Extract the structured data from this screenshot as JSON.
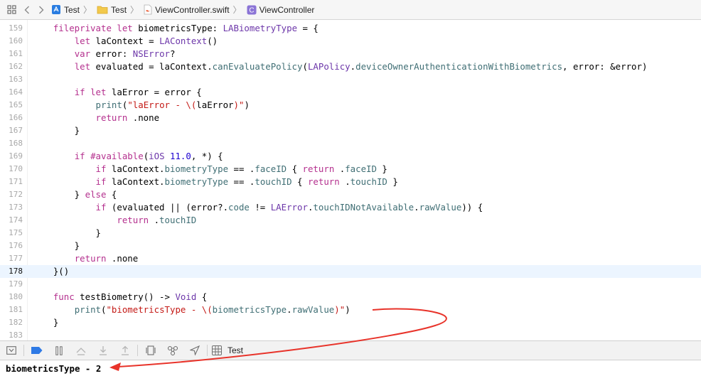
{
  "jumpbar": {
    "crumbs": [
      {
        "label": "Test",
        "icon": "project-file-icon"
      },
      {
        "label": "Test",
        "icon": "folder-icon"
      },
      {
        "label": "ViewController.swift",
        "icon": "swift-file-icon"
      },
      {
        "label": "ViewController",
        "icon": "class-c-icon"
      }
    ]
  },
  "editor": {
    "current_line": "178",
    "lines": [
      {
        "n": "159",
        "t": [
          [
            "    ",
            ""
          ],
          [
            "fileprivate",
            "kw"
          ],
          [
            " ",
            ""
          ],
          [
            "let",
            "kw"
          ],
          [
            " biometricsType: ",
            ""
          ],
          [
            "LABiometryType",
            "ty"
          ],
          [
            " = {",
            ""
          ]
        ]
      },
      {
        "n": "160",
        "t": [
          [
            "        ",
            ""
          ],
          [
            "let",
            "kw"
          ],
          [
            " laContext = ",
            ""
          ],
          [
            "LAContext",
            "ty"
          ],
          [
            "()",
            ""
          ]
        ]
      },
      {
        "n": "161",
        "t": [
          [
            "        ",
            ""
          ],
          [
            "var",
            "kw"
          ],
          [
            " error: ",
            ""
          ],
          [
            "NSError",
            "ty"
          ],
          [
            "?",
            ""
          ]
        ]
      },
      {
        "n": "162",
        "t": [
          [
            "        ",
            ""
          ],
          [
            "let",
            "kw"
          ],
          [
            " evaluated = laContext.",
            ""
          ],
          [
            "canEvaluatePolicy",
            "fn"
          ],
          [
            "(",
            ""
          ],
          [
            "LAPolicy",
            "ty"
          ],
          [
            ".",
            ""
          ],
          [
            "deviceOwnerAuthenticationWithBiometrics",
            "fn"
          ],
          [
            ", error: &error)",
            ""
          ]
        ]
      },
      {
        "n": "163",
        "t": []
      },
      {
        "n": "164",
        "t": [
          [
            "        ",
            ""
          ],
          [
            "if",
            "kw"
          ],
          [
            " ",
            ""
          ],
          [
            "let",
            "kw"
          ],
          [
            " laError = error {",
            ""
          ]
        ]
      },
      {
        "n": "165",
        "t": [
          [
            "            ",
            ""
          ],
          [
            "print",
            "fn"
          ],
          [
            "(",
            ""
          ],
          [
            "\"laError - \\(",
            ""
          ],
          [
            "laError",
            ""
          ],
          [
            ")\"",
            "st"
          ],
          [
            ")",
            ""
          ]
        ]
      },
      {
        "n": "166",
        "t": [
          [
            "            ",
            ""
          ],
          [
            "return",
            "kw"
          ],
          [
            " .none",
            ""
          ]
        ]
      },
      {
        "n": "167",
        "t": [
          [
            "        }",
            ""
          ]
        ]
      },
      {
        "n": "168",
        "t": []
      },
      {
        "n": "169",
        "t": [
          [
            "        ",
            ""
          ],
          [
            "if",
            "kw"
          ],
          [
            " ",
            ""
          ],
          [
            "#available",
            "kw"
          ],
          [
            "(",
            ""
          ],
          [
            "iOS",
            "ty"
          ],
          [
            " ",
            ""
          ],
          [
            "11.0",
            "num"
          ],
          [
            ", *) {",
            ""
          ]
        ]
      },
      {
        "n": "170",
        "t": [
          [
            "            ",
            ""
          ],
          [
            "if",
            "kw"
          ],
          [
            " laContext.",
            ""
          ],
          [
            "biometryType",
            "fn"
          ],
          [
            " == .",
            ""
          ],
          [
            "faceID",
            "fn"
          ],
          [
            " { ",
            ""
          ],
          [
            "return",
            "kw"
          ],
          [
            " .",
            ""
          ],
          [
            "faceID",
            "fn"
          ],
          [
            " }",
            ""
          ]
        ]
      },
      {
        "n": "171",
        "t": [
          [
            "            ",
            ""
          ],
          [
            "if",
            "kw"
          ],
          [
            " laContext.",
            ""
          ],
          [
            "biometryType",
            "fn"
          ],
          [
            " == .",
            ""
          ],
          [
            "touchID",
            "fn"
          ],
          [
            " { ",
            ""
          ],
          [
            "return",
            "kw"
          ],
          [
            " .",
            ""
          ],
          [
            "touchID",
            "fn"
          ],
          [
            " }",
            ""
          ]
        ]
      },
      {
        "n": "172",
        "t": [
          [
            "        } ",
            ""
          ],
          [
            "else",
            "kw"
          ],
          [
            " {",
            ""
          ]
        ]
      },
      {
        "n": "173",
        "t": [
          [
            "            ",
            ""
          ],
          [
            "if",
            "kw"
          ],
          [
            " (evaluated || (error?.",
            ""
          ],
          [
            "code",
            "fn"
          ],
          [
            " != ",
            ""
          ],
          [
            "LAError",
            "ty"
          ],
          [
            ".",
            ""
          ],
          [
            "touchIDNotAvailable",
            "fn"
          ],
          [
            ".",
            ""
          ],
          [
            "rawValue",
            "fn"
          ],
          [
            ")) {",
            ""
          ]
        ]
      },
      {
        "n": "174",
        "t": [
          [
            "                ",
            ""
          ],
          [
            "return",
            "kw"
          ],
          [
            " .",
            ""
          ],
          [
            "touchID",
            "fn"
          ]
        ]
      },
      {
        "n": "175",
        "t": [
          [
            "            }",
            ""
          ]
        ]
      },
      {
        "n": "176",
        "t": [
          [
            "        }",
            ""
          ]
        ]
      },
      {
        "n": "177",
        "t": [
          [
            "        ",
            ""
          ],
          [
            "return",
            "kw"
          ],
          [
            " .none",
            ""
          ]
        ]
      },
      {
        "n": "178",
        "t": [
          [
            "    }()",
            ""
          ]
        ]
      },
      {
        "n": "179",
        "t": []
      },
      {
        "n": "180",
        "t": [
          [
            "    ",
            ""
          ],
          [
            "func",
            "kw"
          ],
          [
            " testBiometry() -> ",
            ""
          ],
          [
            "Void",
            "ty"
          ],
          [
            " {",
            ""
          ]
        ]
      },
      {
        "n": "181",
        "t": [
          [
            "        ",
            ""
          ],
          [
            "print",
            "fn"
          ],
          [
            "(",
            ""
          ],
          [
            "\"biometricsType - \\(",
            "st"
          ],
          [
            "biometricsType",
            "fn"
          ],
          [
            ".",
            ""
          ],
          [
            "rawValue",
            "fn"
          ],
          [
            ")\"",
            "st"
          ],
          [
            ")",
            ""
          ]
        ]
      },
      {
        "n": "182",
        "t": [
          [
            "    }",
            ""
          ]
        ]
      },
      {
        "n": "183",
        "t": []
      }
    ]
  },
  "debugbar": {
    "target": "Test"
  },
  "console": {
    "output": "biometricsType - 2"
  },
  "colors": {
    "keyword": "#b4308e",
    "type": "#6c36a9",
    "string": "#c41a16",
    "member": "#3f6e74",
    "number": "#1c00cf",
    "breakpoint_blue": "#2f7ae5",
    "annotation_red": "#e8332a"
  }
}
